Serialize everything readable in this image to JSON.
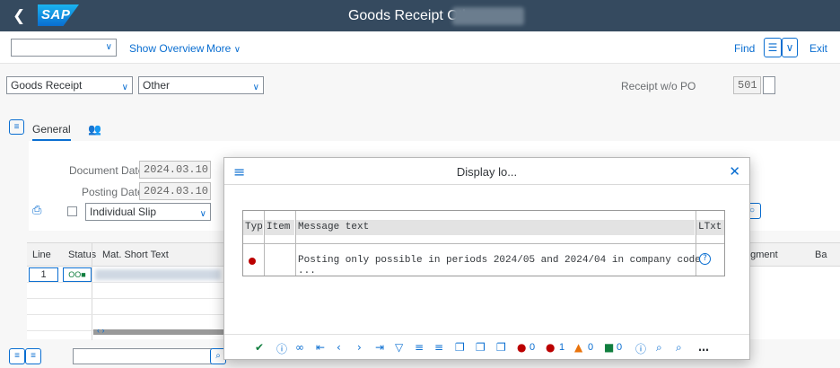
{
  "shell": {
    "title": "Goods Receipt Other -",
    "logo": "SAP",
    "back_icon": "chevron-left-icon"
  },
  "toolbar": {
    "show_overview": "Show Overview",
    "more": "More",
    "find": "Find",
    "exit": "Exit"
  },
  "header": {
    "transaction": "Goods Receipt",
    "reference": "Other",
    "movement_label": "Receipt w/o PO",
    "movement_type": "501"
  },
  "tabs": [
    {
      "label": "General"
    }
  ],
  "general": {
    "doc_date_label": "Document Date:",
    "doc_date": "2024.03.10",
    "posting_date_label": "Posting Date:",
    "posting_date": "2024.03.10",
    "slip": "Individual Slip"
  },
  "grid": {
    "headers": {
      "line": "Line",
      "status": "Status",
      "mat": "Mat. Short Text",
      "segment": "egment",
      "ba": "Ba"
    },
    "rows": [
      {
        "line": "1",
        "status": "OO■"
      }
    ],
    "nav": "‹ ›"
  },
  "dialog": {
    "title": "Display lo...",
    "columns": {
      "typ": "Typ",
      "item": "Item",
      "msg": "Message text",
      "ltxt": "LTxt"
    },
    "messages": [
      {
        "type": "error",
        "item": "",
        "text": "Posting only possible in periods 2024/05 and 2024/04 in company code ..."
      }
    ],
    "counts": {
      "stop": "0",
      "error": "1",
      "warning": "0",
      "success": "0"
    }
  },
  "colors": {
    "shell": "#354a5f",
    "accent": "#0a6ed1",
    "error": "#bb0000",
    "warning": "#e9730c",
    "success": "#107e3e"
  }
}
